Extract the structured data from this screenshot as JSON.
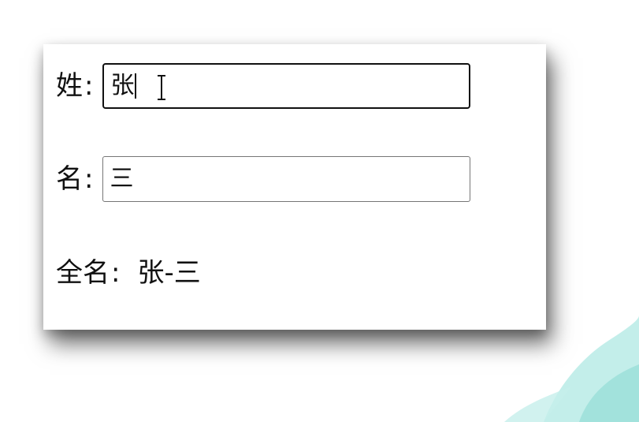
{
  "form": {
    "last_name": {
      "label": "姓",
      "colon": ":",
      "value": "张"
    },
    "first_name": {
      "label": "名",
      "colon": ":",
      "value": "三"
    },
    "full_name": {
      "label": "全名",
      "colon": ":",
      "value": "张-三"
    }
  },
  "icons": {
    "text_cursor": "text-cursor-icon",
    "decoration": "teal-leaf-icon"
  },
  "colors": {
    "decor_teal": "#a9e4df",
    "focused_border": "#111111",
    "field_border": "#767676"
  }
}
